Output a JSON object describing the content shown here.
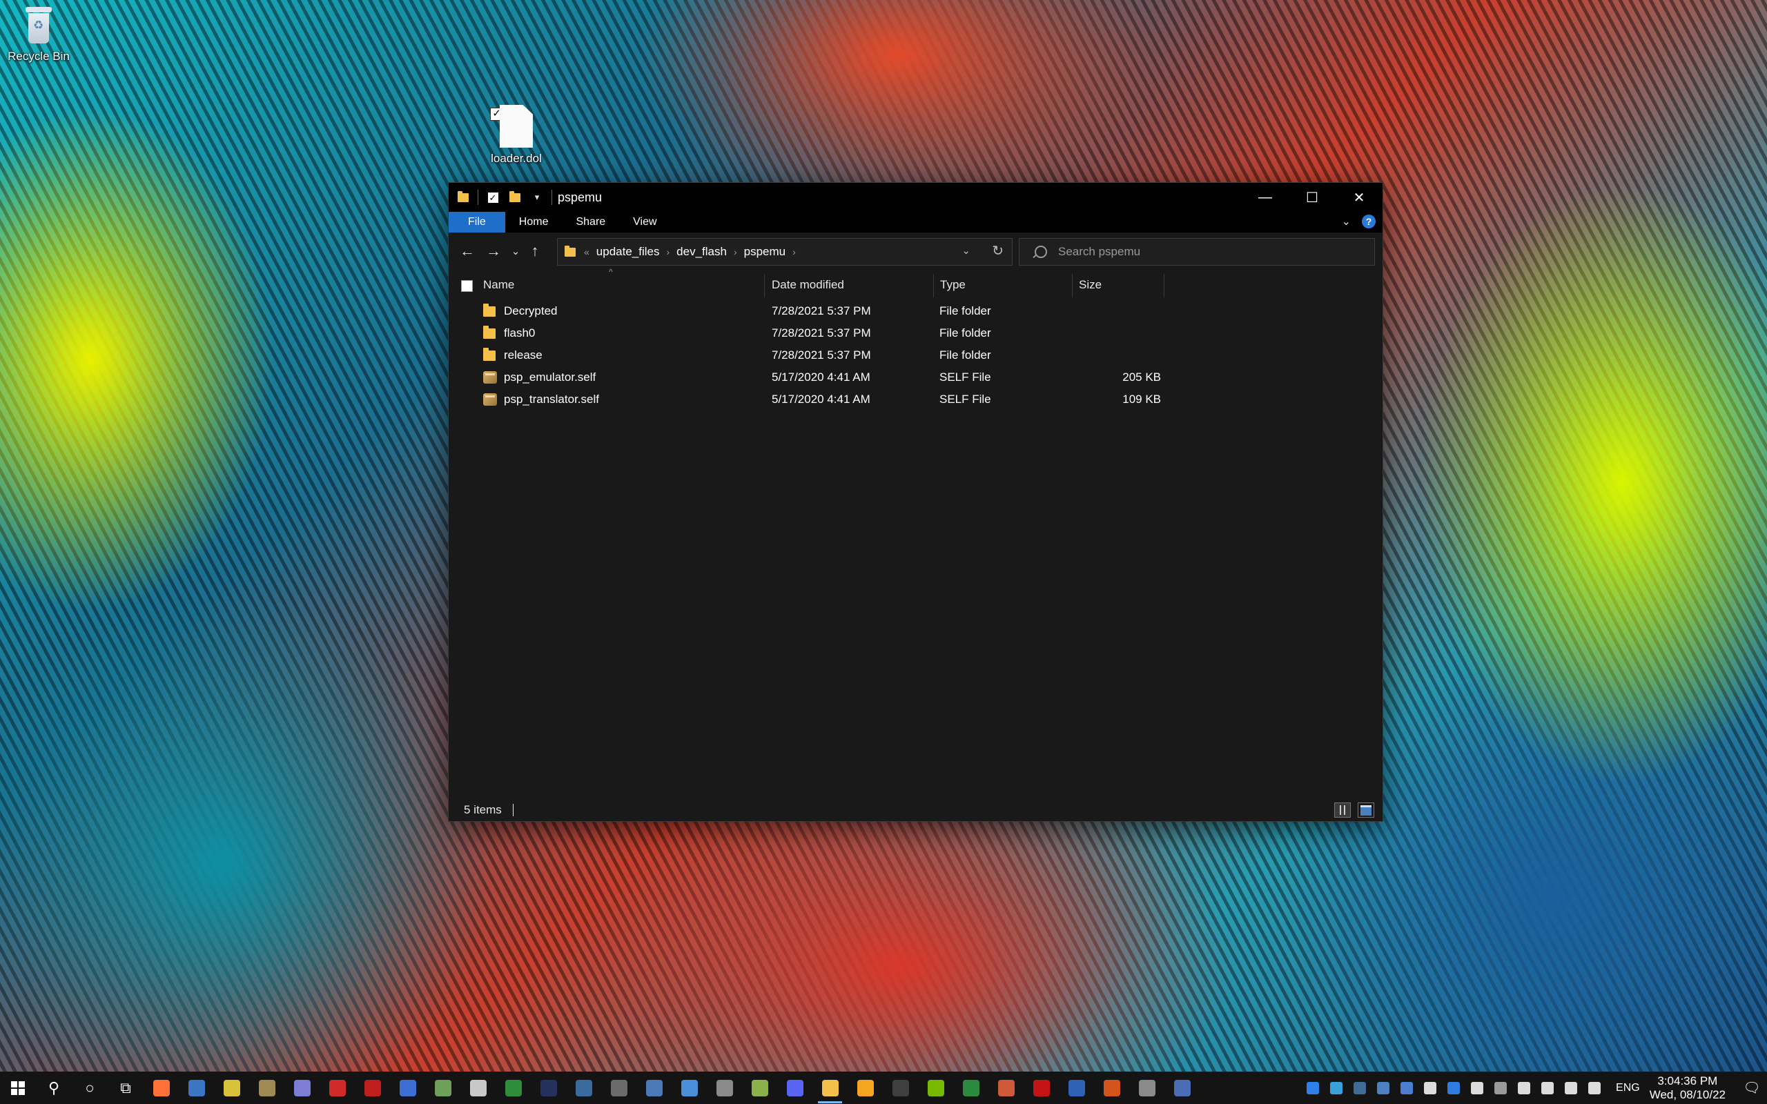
{
  "desktop": {
    "recycle_bin_label": "Recycle Bin",
    "file_label": "loader.dol"
  },
  "window": {
    "title": "pspemu",
    "ribbon_tabs": [
      "File",
      "Home",
      "Share",
      "View"
    ],
    "address": {
      "crumbs": [
        "update_files",
        "dev_flash",
        "pspemu"
      ],
      "more_glyph": "«"
    },
    "search_placeholder": "Search pspemu",
    "columns": [
      "Name",
      "Date modified",
      "Type",
      "Size"
    ],
    "files": [
      {
        "name": "Decrypted",
        "date": "7/28/2021 5:37 PM",
        "type": "File folder",
        "size": "",
        "icon": "folder-icon"
      },
      {
        "name": "flash0",
        "date": "7/28/2021 5:37 PM",
        "type": "File folder",
        "size": "",
        "icon": "folder-icon"
      },
      {
        "name": "release",
        "date": "7/28/2021 5:37 PM",
        "type": "File folder",
        "size": "",
        "icon": "folder-icon"
      },
      {
        "name": "psp_emulator.self",
        "date": "5/17/2020 4:41 AM",
        "type": "SELF File",
        "size": "205 KB",
        "icon": "package-file-icon"
      },
      {
        "name": "psp_translator.self",
        "date": "5/17/2020 4:41 AM",
        "type": "SELF File",
        "size": "109 KB",
        "icon": "package-file-icon"
      }
    ],
    "status": "5 items"
  },
  "taskbar": {
    "apps": [
      {
        "name": "firefox-icon",
        "color": "#ff7139"
      },
      {
        "name": "browser-icon",
        "color": "#3a76c4"
      },
      {
        "name": "torrent-icon",
        "color": "#d8c23a"
      },
      {
        "name": "disc-icon",
        "color": "#9e8a52"
      },
      {
        "name": "rocket-icon",
        "color": "#7d7dd6"
      },
      {
        "name": "app-qp-icon",
        "color": "#d02a2a"
      },
      {
        "name": "filezilla-icon",
        "color": "#bf1e1e"
      },
      {
        "name": "window-app-icon",
        "color": "#3c6fd1"
      },
      {
        "name": "map-icon",
        "color": "#6ea05a"
      },
      {
        "name": "archive-icon",
        "color": "#c8c8c8"
      },
      {
        "name": "sheet-icon",
        "color": "#2f8c3a"
      },
      {
        "name": "photoshop-icon",
        "color": "#26305e"
      },
      {
        "name": "monitor-icon",
        "color": "#3b6a9e"
      },
      {
        "name": "keyboard-icon",
        "color": "#6b6b6b"
      },
      {
        "name": "calculator-icon",
        "color": "#4b79b8"
      },
      {
        "name": "paint-icon",
        "color": "#4a90d9"
      },
      {
        "name": "cursor-icon",
        "color": "#8a8a8a"
      },
      {
        "name": "brush-icon",
        "color": "#8bb24a"
      },
      {
        "name": "discord-icon",
        "color": "#5865f2"
      },
      {
        "name": "file-explorer-icon",
        "color": "#f3c14b",
        "running": true
      },
      {
        "name": "weather-icon",
        "color": "#f4a623"
      },
      {
        "name": "game-icon",
        "color": "#404040"
      },
      {
        "name": "nvidia-icon",
        "color": "#76b900"
      },
      {
        "name": "excel-icon",
        "color": "#2c8a3e"
      },
      {
        "name": "docker-icon",
        "color": "#cf5a3a"
      },
      {
        "name": "acrobat-icon",
        "color": "#c41515"
      },
      {
        "name": "font-icon",
        "color": "#2f62b6"
      },
      {
        "name": "ccleaner-icon",
        "color": "#d4551c"
      },
      {
        "name": "printer-icon",
        "color": "#8a8a8a"
      },
      {
        "name": "network-icon",
        "color": "#4a6db5"
      }
    ],
    "tray_icons": [
      {
        "name": "lightning-icon",
        "color": "#2f80ed"
      },
      {
        "name": "sync-icon",
        "color": "#3aa0d8"
      },
      {
        "name": "steam-icon",
        "color": "#3f6b94"
      },
      {
        "name": "lifebuoy-icon",
        "color": "#4d7fc3"
      },
      {
        "name": "qbittorrent-icon",
        "color": "#4a7fcf"
      },
      {
        "name": "download-icon",
        "color": "#dcdcdc"
      },
      {
        "name": "bluetooth-icon",
        "color": "#2f7de0"
      },
      {
        "name": "defender-icon",
        "color": "#dcdcdc"
      },
      {
        "name": "device-icon",
        "color": "#9a9a9a"
      },
      {
        "name": "battery-icon",
        "color": "#dcdcdc"
      },
      {
        "name": "wifi-icon",
        "color": "#dcdcdc"
      },
      {
        "name": "volume-icon",
        "color": "#dcdcdc"
      },
      {
        "name": "usb-icon",
        "color": "#dcdcdc"
      }
    ],
    "language": "ENG",
    "time": "3:04:36 PM",
    "date": "Wed, 08/10/22"
  }
}
